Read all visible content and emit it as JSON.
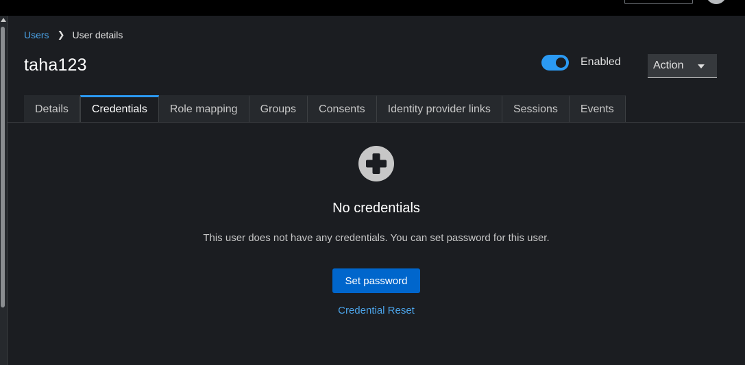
{
  "breadcrumb": {
    "parent": "Users",
    "current": "User details"
  },
  "header": {
    "title": "taha123",
    "enabled_label": "Enabled",
    "enabled": true,
    "action_label": "Action"
  },
  "tabs": [
    {
      "label": "Details",
      "active": false
    },
    {
      "label": "Credentials",
      "active": true
    },
    {
      "label": "Role mapping",
      "active": false
    },
    {
      "label": "Groups",
      "active": false
    },
    {
      "label": "Consents",
      "active": false
    },
    {
      "label": "Identity provider links",
      "active": false
    },
    {
      "label": "Sessions",
      "active": false
    },
    {
      "label": "Events",
      "active": false
    }
  ],
  "empty_state": {
    "icon": "plus-circle-icon",
    "title": "No credentials",
    "body": "This user does not have any credentials. You can set password for this user.",
    "primary_action": "Set password",
    "secondary_action": "Credential Reset"
  },
  "colors": {
    "background": "#1b1d21",
    "accent": "#2b9af3",
    "primary_button": "#0066cc",
    "link": "#4ba3e8"
  }
}
